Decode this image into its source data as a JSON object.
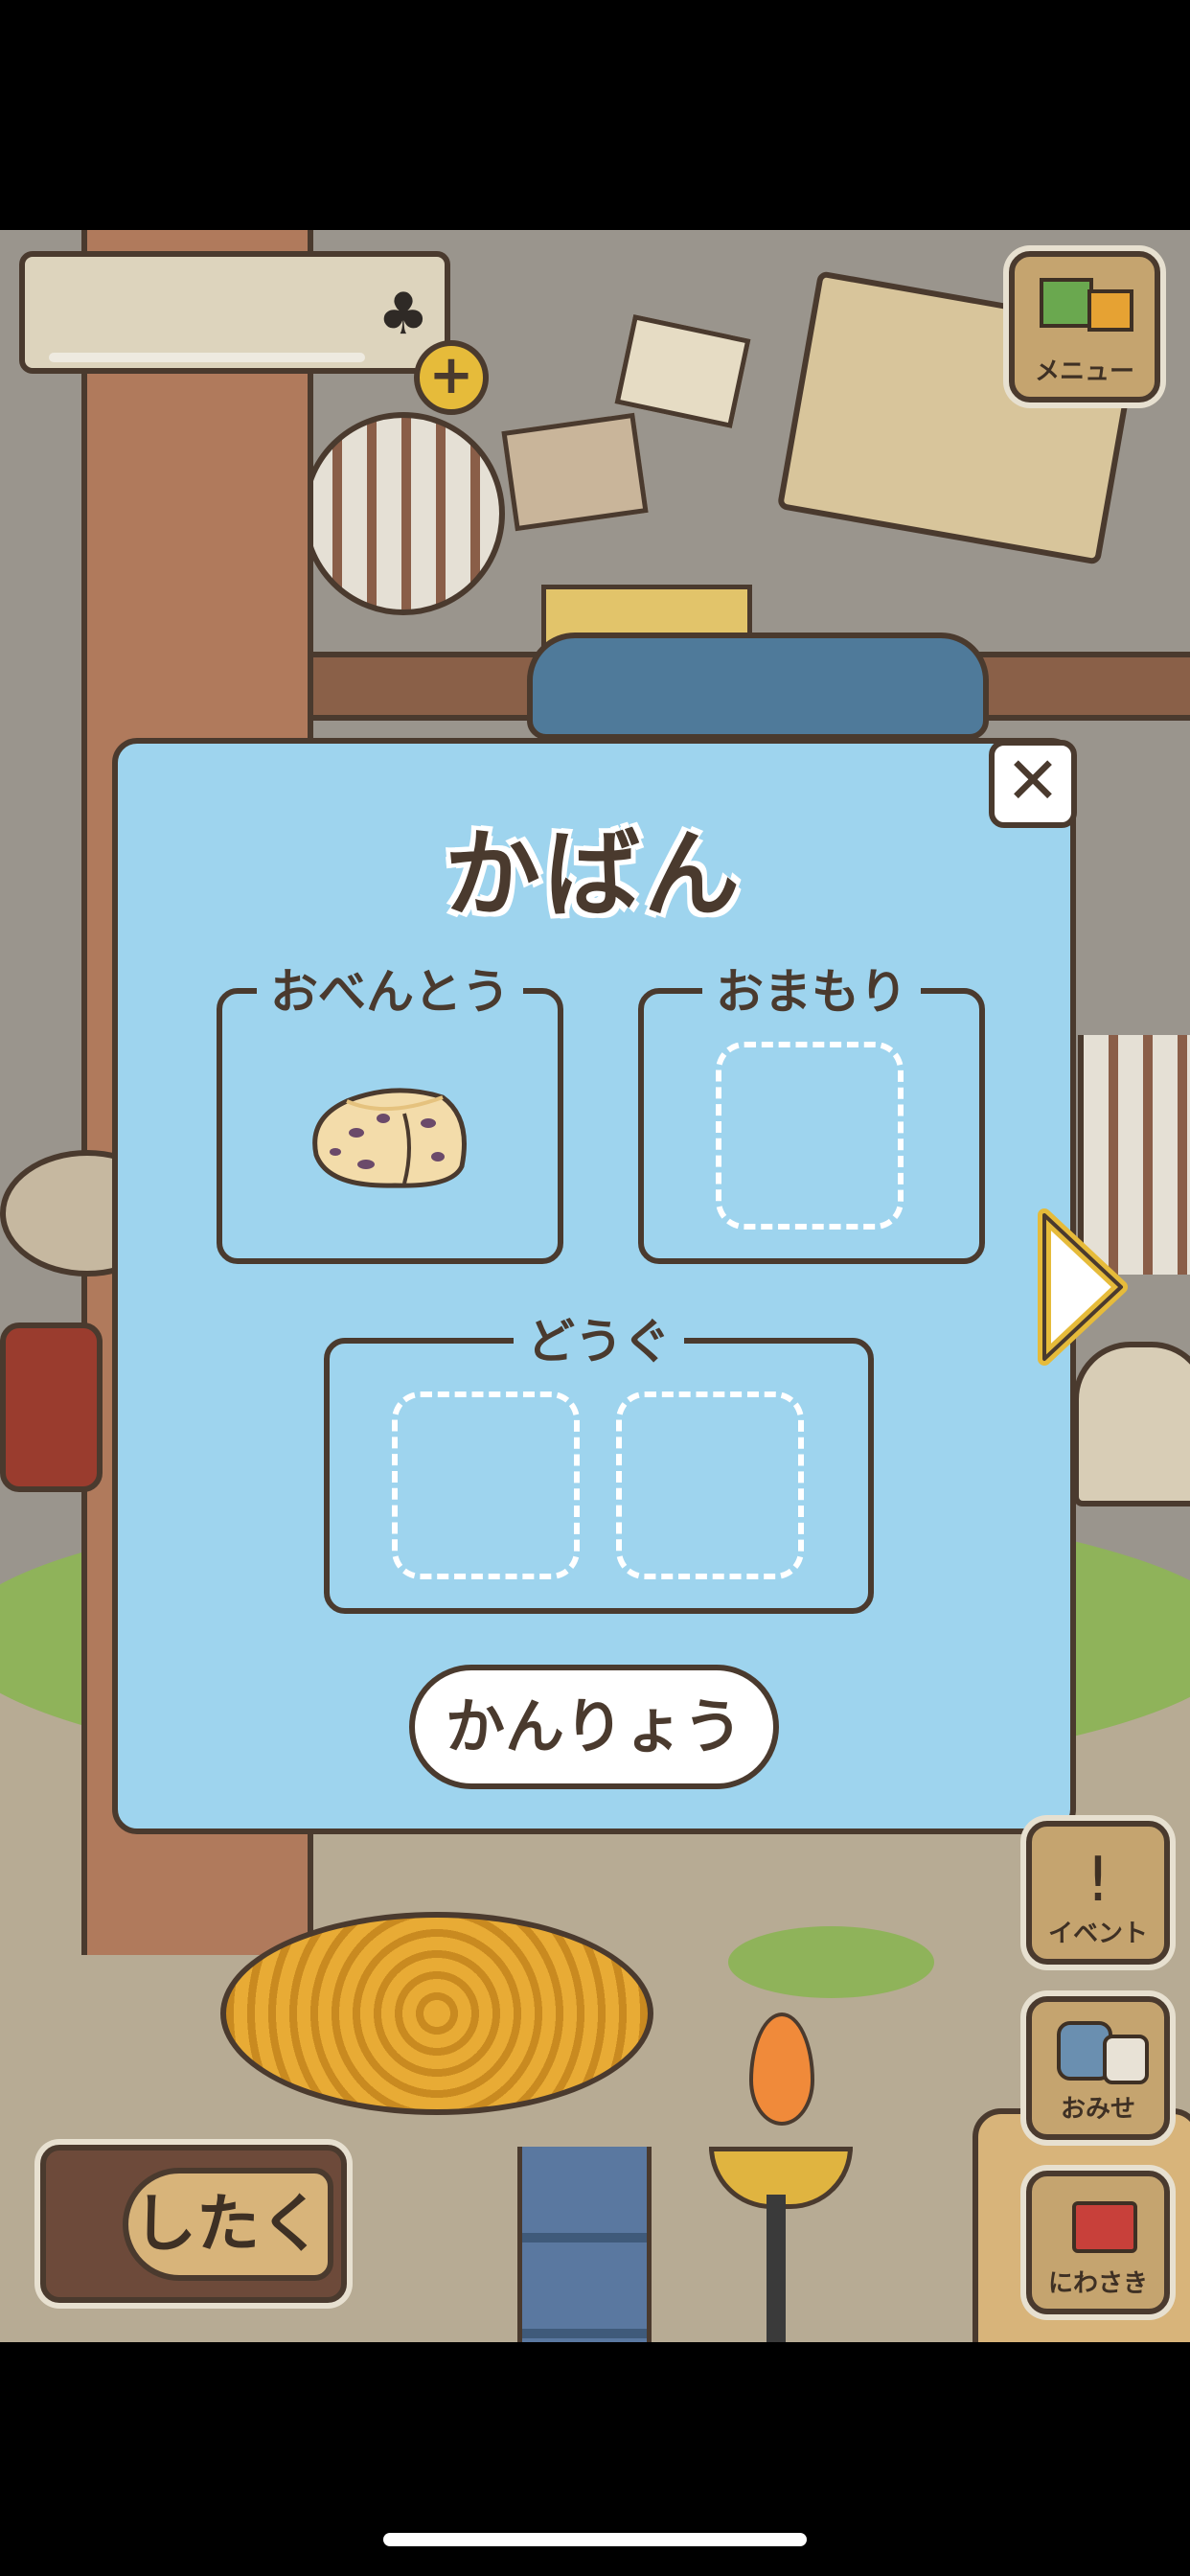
{
  "hud": {
    "clover_icon": "♣",
    "plus_label": "+"
  },
  "side_menu": {
    "menu_label": "メニュー",
    "event_label": "イベント",
    "event_icon": "!",
    "shop_label": "おみせ",
    "garden_label": "にわさき"
  },
  "bag_modal": {
    "title": "かばん",
    "close_label": "✕",
    "slots": {
      "lunch_label": "おべんとう",
      "lunch_item": "scone",
      "charm_label": "おまもり",
      "tools_label": "どうぐ"
    },
    "confirm_label": "かんりょう"
  },
  "prepare_button": {
    "label": "したく"
  },
  "colors": {
    "modal_bg": "#9ed4ee",
    "outline": "#4a3a2e",
    "button_wood": "#c5a46f",
    "clover_btn": "#e6bb3a"
  }
}
